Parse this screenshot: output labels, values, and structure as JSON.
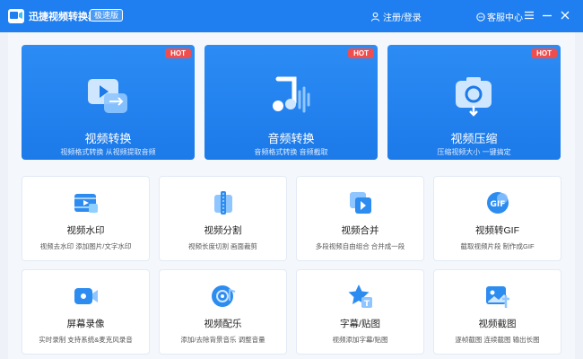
{
  "titlebar": {
    "app_title": "迅捷视频转换器",
    "edition_badge": "极速版",
    "login_label": "注册/登录",
    "support_label": "客服中心"
  },
  "colors": {
    "accent": "#1f7ff0",
    "hot_badge": "#f04e4e",
    "card_bg": "#ffffff"
  },
  "featured": [
    {
      "title": "视频转换",
      "subtitle": "视频格式转换 从视频提取音频",
      "badge": "HOT",
      "icon": "video-convert-icon"
    },
    {
      "title": "音频转换",
      "subtitle": "音频格式转换 音频截取",
      "badge": "HOT",
      "icon": "audio-convert-icon"
    },
    {
      "title": "视频压缩",
      "subtitle": "压缩视频大小 一键搞定",
      "badge": "HOT",
      "icon": "video-compress-icon"
    }
  ],
  "tools": [
    {
      "title": "视频水印",
      "subtitle": "视频去水印 添加图片/文字水印",
      "icon": "video-watermark-icon"
    },
    {
      "title": "视频分割",
      "subtitle": "视频长度切割 画面裁剪",
      "icon": "video-split-icon"
    },
    {
      "title": "视频合并",
      "subtitle": "多段视频自由组合 合并成一段",
      "icon": "video-merge-icon"
    },
    {
      "title": "视频转GIF",
      "subtitle": "截取视频片段 制作成GIF",
      "icon": "video-to-gif-icon"
    },
    {
      "title": "屏幕录像",
      "subtitle": "实时录制 支持系统&麦克风录音",
      "icon": "screen-record-icon"
    },
    {
      "title": "视频配乐",
      "subtitle": "添加/去除背景音乐 调整音量",
      "icon": "video-music-icon"
    },
    {
      "title": "字幕/贴图",
      "subtitle": "视频添加字幕/贴图",
      "icon": "subtitle-sticker-icon"
    },
    {
      "title": "视频截图",
      "subtitle": "逐帧截图 连续截图 输出长图",
      "icon": "video-screenshot-icon"
    }
  ]
}
